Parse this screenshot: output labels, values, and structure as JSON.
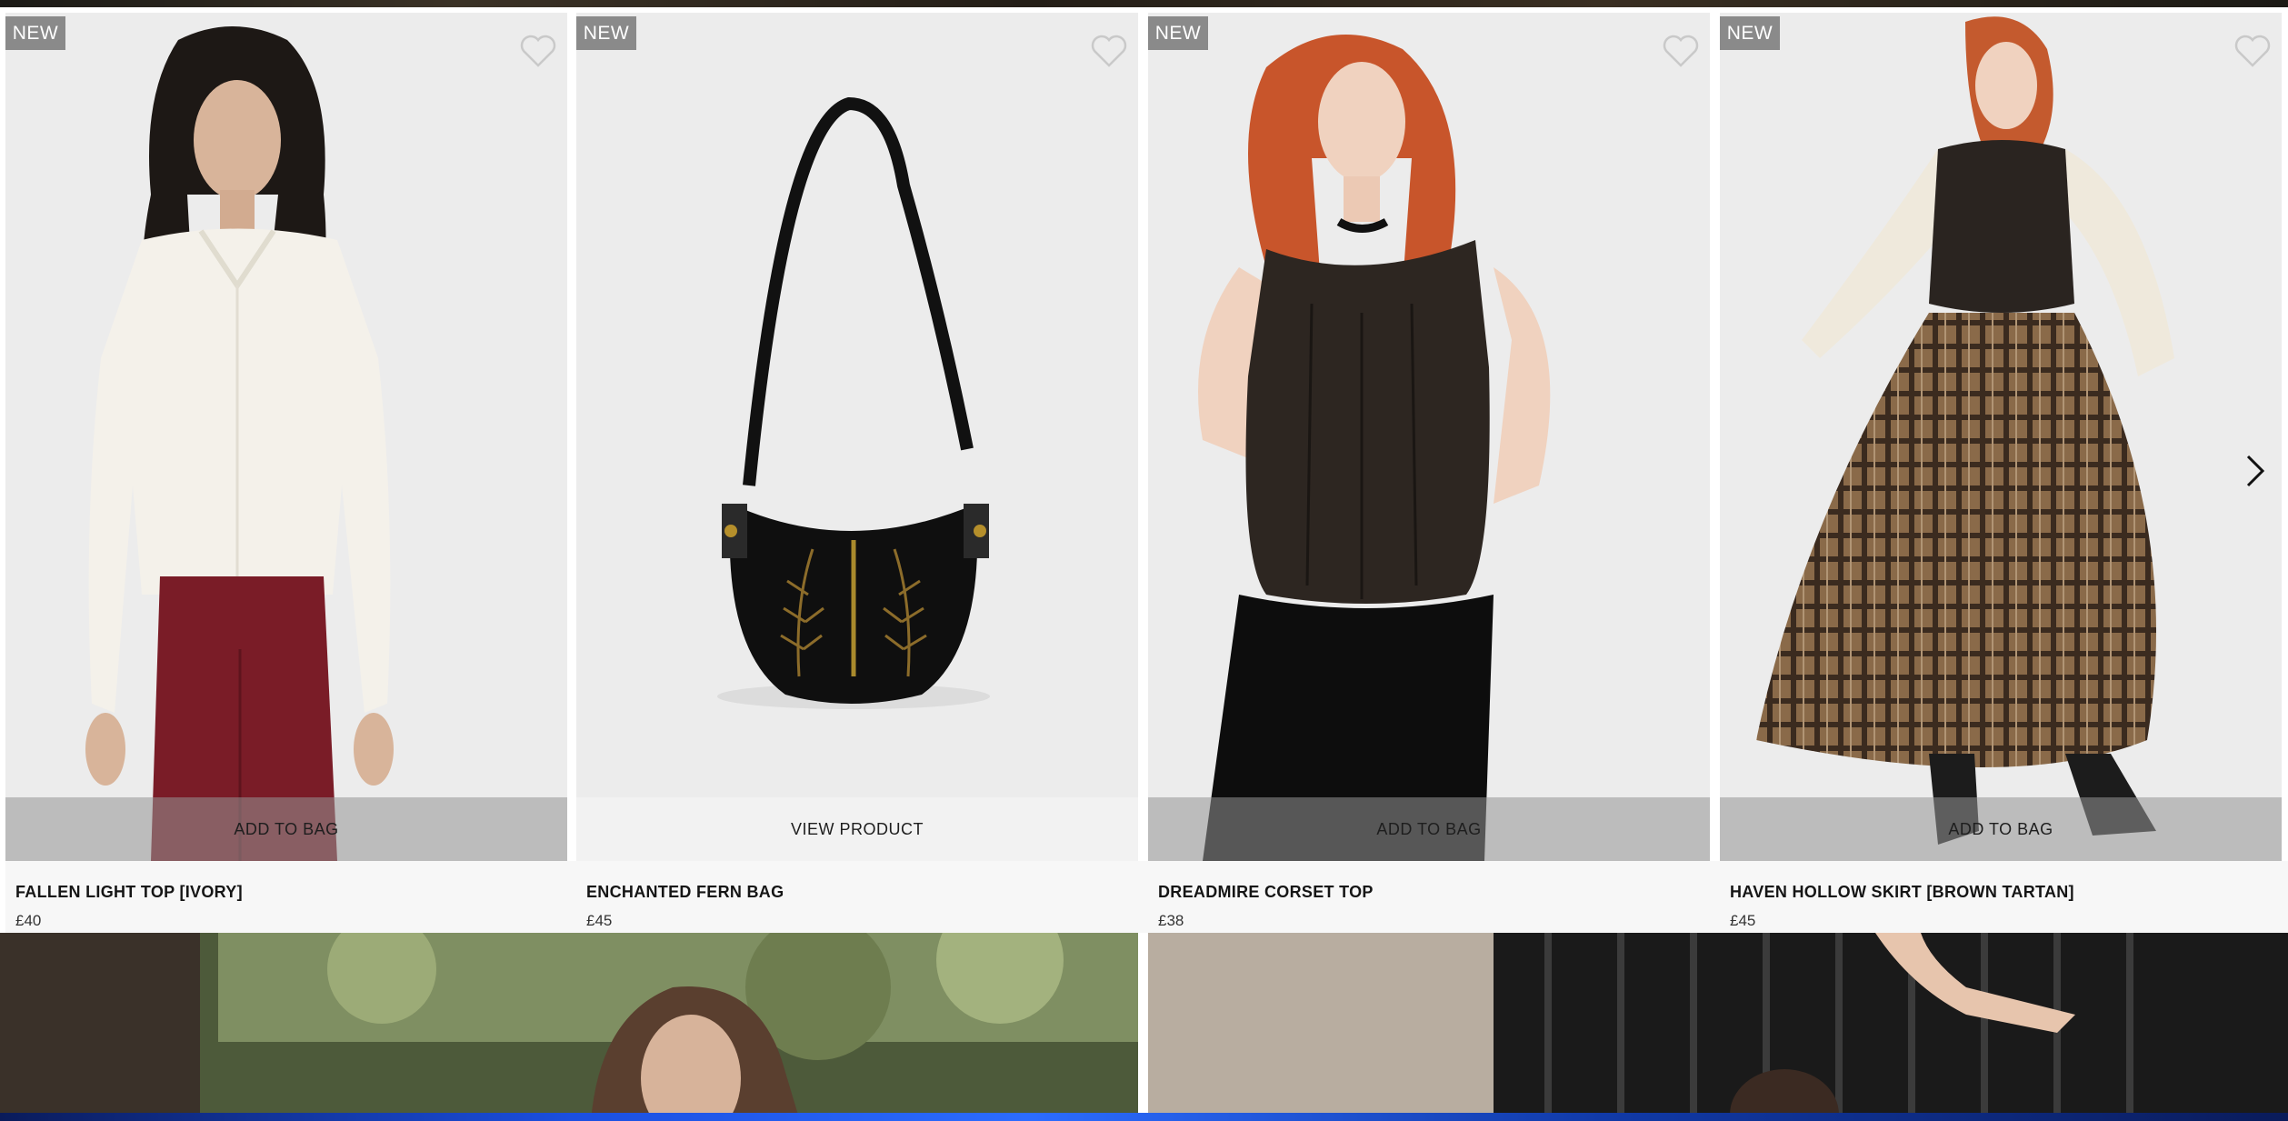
{
  "products": [
    {
      "badge": "NEW",
      "cta": "ADD TO BAG",
      "title": "FALLEN LIGHT TOP [IVORY]",
      "price": "£40"
    },
    {
      "badge": "NEW",
      "cta": "VIEW PRODUCT",
      "title": "ENCHANTED FERN BAG",
      "price": "£45"
    },
    {
      "badge": "NEW",
      "cta": "ADD TO BAG",
      "title": "DREADMIRE CORSET TOP",
      "price": "£38"
    },
    {
      "badge": "NEW",
      "cta": "ADD TO BAG",
      "title": "HAVEN HOLLOW SKIRT [BROWN TARTAN]",
      "price": "£45"
    }
  ],
  "carousel": {
    "next_icon": "chevron-right-icon"
  },
  "icons": {
    "wishlist": "heart-outline-icon"
  },
  "colors": {
    "badge_bg": "#8a8a8a",
    "card_bg": "#ededed",
    "text": "#151515"
  }
}
